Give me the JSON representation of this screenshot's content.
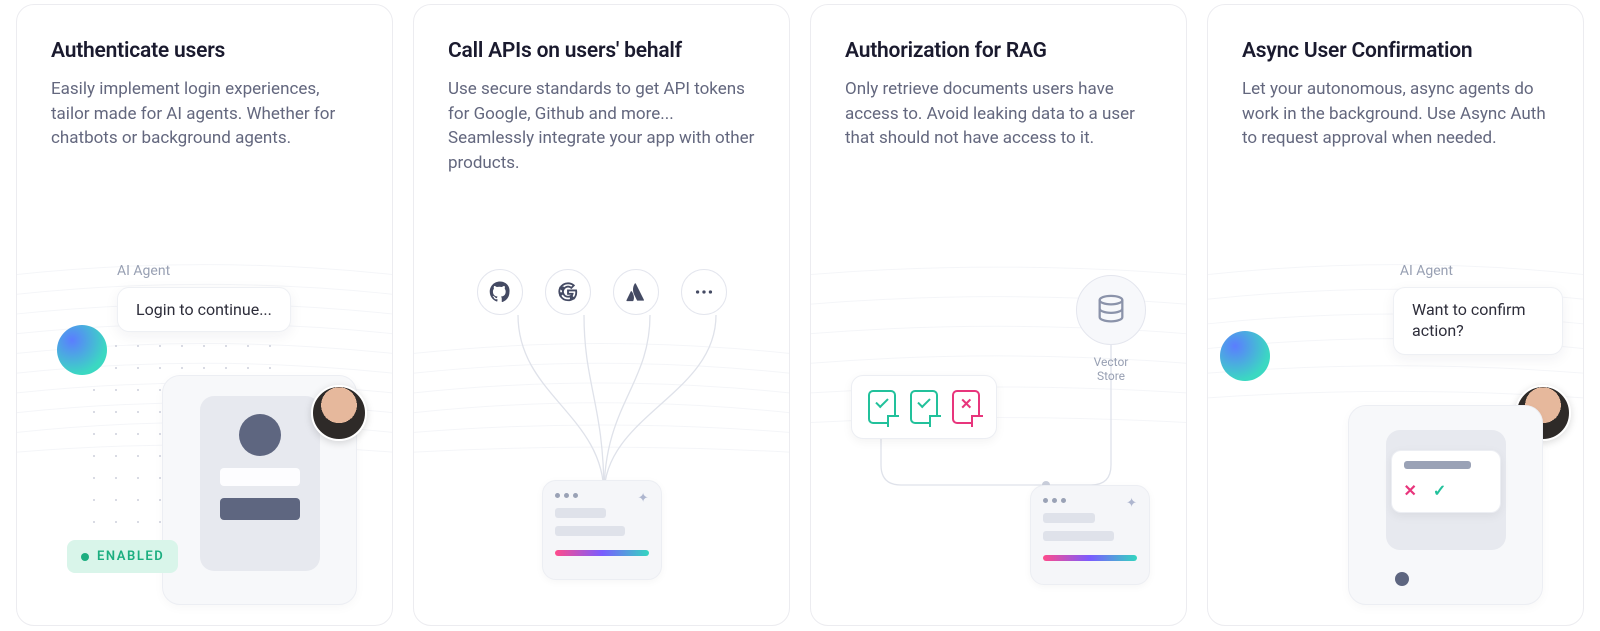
{
  "cards": [
    {
      "title": "Authenticate users",
      "desc": "Easily implement login experiences, tailor made for AI agents. Whether for chatbots or background agents.",
      "agent_label": "AI Agent",
      "bubble": "Login to continue...",
      "badge": "ENABLED"
    },
    {
      "title": "Call APIs on users' behalf",
      "desc": "Use secure standards to get API tokens for Google, Github and more... Seamlessly integrate your app with other products.",
      "providers": [
        "github",
        "google",
        "atlassian",
        "more"
      ]
    },
    {
      "title": "Authorization for RAG",
      "desc": "Only retrieve documents users have access to. Avoid leaking data to a user that should not have access to it.",
      "vector_store_label": "Vector\nStore",
      "doc_states": [
        "allowed",
        "allowed",
        "denied"
      ]
    },
    {
      "title": "Async User Confirmation",
      "desc": "Let your autonomous, async agents do work in the background. Use Async Auth to request approval when needed.",
      "agent_label": "AI Agent",
      "bubble": "Want to confirm action?"
    }
  ]
}
